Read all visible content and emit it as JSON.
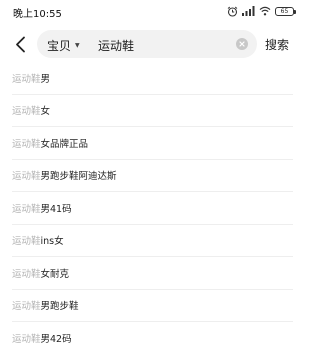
{
  "status_bar": {
    "time": "晚上10:55",
    "battery": "65",
    "icons": [
      "alarm-icon",
      "signal-icon",
      "wifi-icon",
      "battery-icon"
    ]
  },
  "search": {
    "scope": "宝贝",
    "query": "运动鞋",
    "submit_label": "搜索"
  },
  "suggestions": [
    {
      "prefix": "运动鞋",
      "suffix": "男"
    },
    {
      "prefix": "运动鞋",
      "suffix": "女"
    },
    {
      "prefix": "运动鞋",
      "suffix": "女品牌正品"
    },
    {
      "prefix": "运动鞋",
      "suffix": "男跑步鞋阿迪达斯"
    },
    {
      "prefix": "运动鞋",
      "suffix": "男41码"
    },
    {
      "prefix": "运动鞋",
      "suffix": "ins女"
    },
    {
      "prefix": "运动鞋",
      "suffix": "女耐克"
    },
    {
      "prefix": "运动鞋",
      "suffix": "男跑步鞋"
    },
    {
      "prefix": "运动鞋",
      "suffix": "男42码"
    }
  ]
}
